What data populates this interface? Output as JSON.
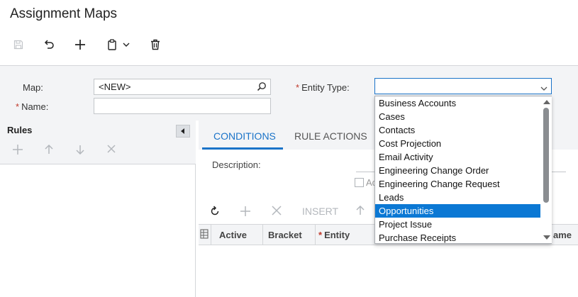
{
  "page": {
    "title": "Assignment Maps"
  },
  "toolbar": {
    "save": "save-icon",
    "undo": "undo-icon",
    "add": "plus-icon",
    "copy_paste": "clipboard-icon",
    "delete": "trash-icon"
  },
  "form": {
    "map_label": "Map:",
    "map_value": "<NEW>",
    "name_label": "Name:",
    "name_value": "",
    "entity_type_label": "Entity Type:",
    "entity_type_value": "",
    "required_mark": "*"
  },
  "rules_panel": {
    "title": "Rules"
  },
  "tabs": [
    {
      "label": "CONDITIONS",
      "active": true
    },
    {
      "label": "RULE ACTIONS",
      "active": false
    }
  ],
  "conditions": {
    "description_label": "Description:",
    "active_checkbox_label": "Ac",
    "insert_label": "INSERT"
  },
  "grid": {
    "columns": [
      "Active",
      "Brackets",
      "Entity",
      "ame"
    ]
  },
  "entity_type_dropdown": {
    "items": [
      "Business Accounts",
      "Cases",
      "Contacts",
      "Cost Projection",
      "Email Activity",
      "Engineering Change Order",
      "Engineering Change Request",
      "Leads",
      "Opportunities",
      "Project Issue",
      "Purchase Receipts"
    ],
    "selected": "Opportunities"
  },
  "colors": {
    "accent": "#1a73c8",
    "selected_bg": "#0b78d4",
    "required": "#c0392b"
  }
}
